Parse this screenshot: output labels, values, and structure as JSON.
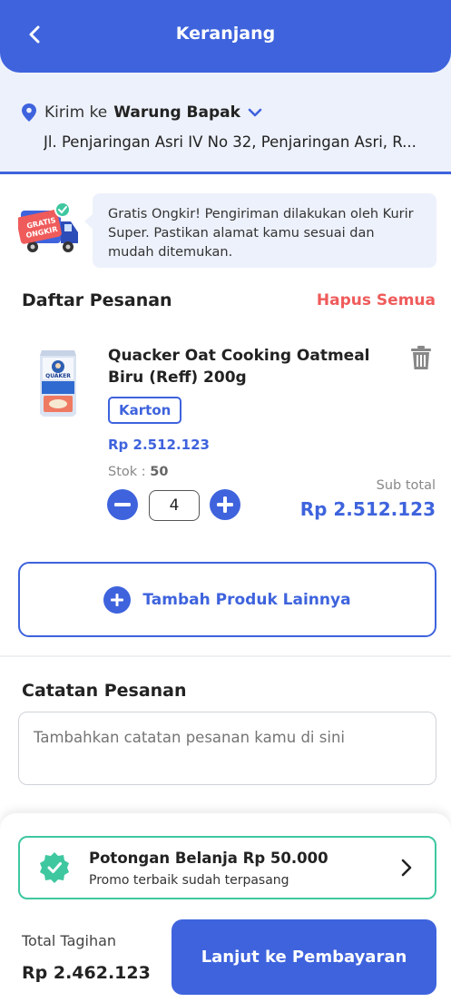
{
  "header": {
    "title": "Keranjang"
  },
  "address": {
    "prefix": "Kirim ke",
    "name": "Warung Bapak",
    "line": "Jl. Penjaringan Asri IV No 32, Penjaringan Asri, R..."
  },
  "promo": {
    "badge_line1": "GRATIS",
    "badge_line2": "ONGKIR",
    "text": "Gratis Ongkir! Pengiriman dilakukan oleh Kurir Super. Pastikan alamat kamu sesuai dan mudah ditemukan."
  },
  "order_list": {
    "title": "Daftar Pesanan",
    "clear_all": "Hapus Semua",
    "items": [
      {
        "name": "Quacker Oat Cooking Oatmeal Biru (Reff) 200g",
        "unit": "Karton",
        "price": "Rp 2.512.123",
        "stock_label": "Stok :",
        "stock_value": "50",
        "quantity": "4",
        "subtotal_label": "Sub total",
        "subtotal": "Rp 2.512.123",
        "image_brand": "QUAKER"
      }
    ]
  },
  "add_product": {
    "label": "Tambah Produk Lainnya"
  },
  "notes": {
    "title": "Catatan Pesanan",
    "placeholder": "Tambahkan catatan pesanan kamu di sini"
  },
  "voucher": {
    "title": "Potongan Belanja Rp 50.000",
    "subtitle": "Promo terbaik sudah terpasang"
  },
  "footer": {
    "total_label": "Total Tagihan",
    "total_value": "Rp 2.462.123",
    "pay_button": "Lanjut ke Pembayaran"
  },
  "colors": {
    "primary": "#3e63dd",
    "danger": "#ef5b5b",
    "success": "#3fc7a0",
    "light_bg": "#edf1fb"
  }
}
